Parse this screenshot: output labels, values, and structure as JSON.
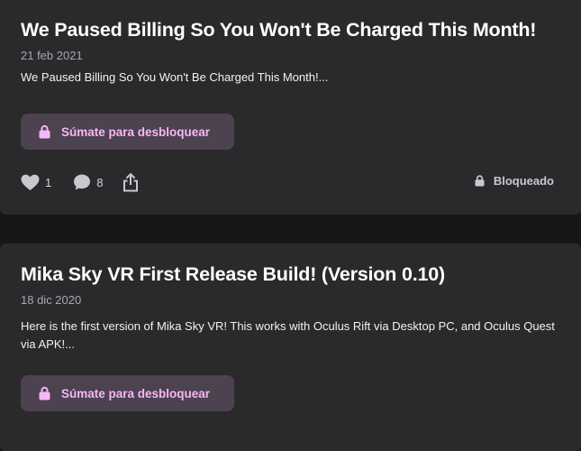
{
  "posts": [
    {
      "title": "We Paused Billing So You Won't Be Charged This Month!",
      "date": "21 feb 2021",
      "excerpt": "We Paused Billing So You Won't Be Charged This Month!...",
      "unlock_label": "Súmate para desbloquear",
      "likes": "1",
      "comments": "8",
      "status": "Bloqueado"
    },
    {
      "title": "Mika Sky VR First Release Build! (Version 0.10)",
      "date": "18 dic 2020",
      "excerpt": "Here is the first version of Mika Sky VR! This works with Oculus Rift via Desktop PC, and Oculus Quest via APK!...",
      "unlock_label": "Súmate para desbloquear"
    }
  ],
  "icons": {
    "lock": "lock-icon",
    "like": "heart-icon",
    "comment": "comment-icon",
    "share": "share-icon"
  },
  "colors": {
    "card_bg": "#2a292c",
    "page_bg": "#161618",
    "button_bg": "#4d4250",
    "button_text": "#f5b8f6"
  }
}
